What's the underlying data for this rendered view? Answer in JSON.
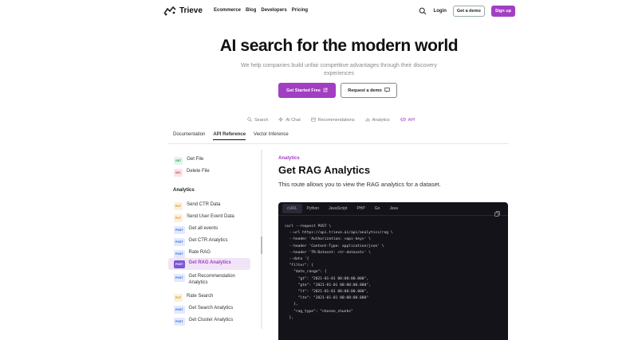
{
  "nav": {
    "brand": "Trieve",
    "links": [
      "Ecommerce",
      "Blog",
      "Developers",
      "Pricing"
    ],
    "login": "Login",
    "get_demo": "Get a demo",
    "signup": "Sign up"
  },
  "hero": {
    "title": "AI search for the modern world",
    "subtitle": "We help companies build unfair competitive advantages through their discovery experiences",
    "cta_primary": "Get Started Free",
    "cta_secondary": "Request a demo"
  },
  "feature_tabs": [
    "Search",
    "AI Chat",
    "Recommendations",
    "Analytics",
    "API"
  ],
  "doc_tabs": [
    "Documentation",
    "API Reference",
    "Vector Inference"
  ],
  "sidebar": {
    "top_items": [
      {
        "method": "GET",
        "label": "Get File"
      },
      {
        "method": "DEL",
        "label": "Delete File"
      }
    ],
    "section": "Analytics",
    "items": [
      {
        "method": "PUT",
        "label": "Send CTR Data"
      },
      {
        "method": "PUT",
        "label": "Send User Event Data"
      },
      {
        "method": "POST",
        "label": "Get all events"
      },
      {
        "method": "POST",
        "label": "Get CTR Analytics"
      },
      {
        "method": "POST",
        "label": "Rate RAG"
      },
      {
        "method": "POST",
        "label": "Get RAG Analytics"
      },
      {
        "method": "POST",
        "label": "Get Recommendation Analytics"
      },
      {
        "method": "PUT",
        "label": "Rate Search"
      },
      {
        "method": "POST",
        "label": "Get Search Analytics"
      },
      {
        "method": "POST",
        "label": "Get Cluster Analytics"
      }
    ],
    "active_label": "Get RAG Analytics"
  },
  "main": {
    "breadcrumb": "Analytics",
    "title": "Get RAG Analytics",
    "description": "This route allows you to view the RAG analytics for a dataset."
  },
  "code": {
    "tabs": [
      "cURL",
      "Python",
      "JavaScript",
      "PHP",
      "Go",
      "Java"
    ],
    "active_tab": "cURL",
    "lines": [
      "curl --request POST \\",
      "  --url https://api.trieve.ai/api/analytics/rag \\",
      "  --header 'Authorization: <api-key>' \\",
      "  --header 'Content-Type: application/json' \\",
      "  --header 'TR-Dataset: <tr-dataset>' \\",
      "  --data '{",
      "  \"filter\": {",
      "    \"date_range\": {",
      "      \"gt\": \"2021-01-01 00:00:00.000\",",
      "      \"gte\": \"2021-01-01 00:00:00.000\",",
      "      \"lt\": \"2021-01-01 00:00:00.000\",",
      "      \"lte\": \"2021-01-01 00:00:00.000\"",
      "    },",
      "    \"rag_type\": \"chosen_chunks\"",
      "  },"
    ]
  },
  "colors": {
    "accent": "#a23ec2",
    "code_bg": "#14131a"
  }
}
